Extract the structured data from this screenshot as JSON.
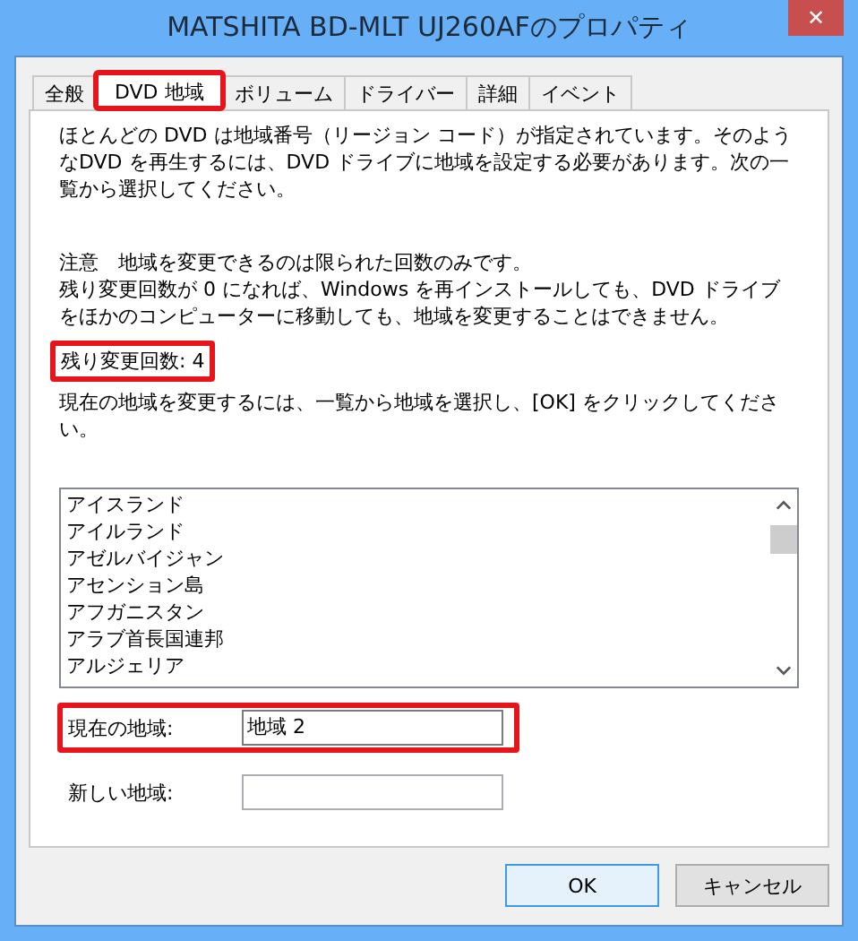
{
  "window": {
    "title": "MATSHITA BD-MLT UJ260AFのプロパティ",
    "close": "✕"
  },
  "tabs": [
    {
      "label": "全般",
      "selected": false,
      "highlighted": false
    },
    {
      "label": "DVD 地域",
      "selected": true,
      "highlighted": true
    },
    {
      "label": "ボリューム",
      "selected": false,
      "highlighted": false
    },
    {
      "label": "ドライバー",
      "selected": false,
      "highlighted": false
    },
    {
      "label": "詳細",
      "selected": false,
      "highlighted": false
    },
    {
      "label": "イベント",
      "selected": false,
      "highlighted": false
    }
  ],
  "intro": "ほとんどの DVD は地域番号（リージョン コード）が指定されています。そのようなDVD を再生するには、DVD ドライブに地域を設定する必要があります。次の一覧から選択してください。",
  "notice": "注意　地域を変更できるのは限られた回数のみです。",
  "warning": "残り変更回数が 0 になれば、Windows を再インストールしても、DVD ドライブをほかのコンピューターに移動しても、地域を変更することはできません。",
  "remaining": {
    "text": "残り変更回数: 4",
    "highlighted": true
  },
  "instruction": "現在の地域を変更するには、一覧から地域を選択し、[OK] をクリックしてください。",
  "region_list": [
    "アイスランド",
    "アイルランド",
    "アゼルバイジャン",
    "アセンション島",
    "アフガニスタン",
    "アラブ首長国連邦",
    "アルジェリア"
  ],
  "current_region": {
    "label": "現在の地域:",
    "value": "地域 2",
    "highlighted": true
  },
  "new_region": {
    "label": "新しい地域:"
  },
  "buttons": [
    {
      "label": "OK",
      "default": true
    },
    {
      "label": "キャンセル",
      "default": false
    }
  ]
}
